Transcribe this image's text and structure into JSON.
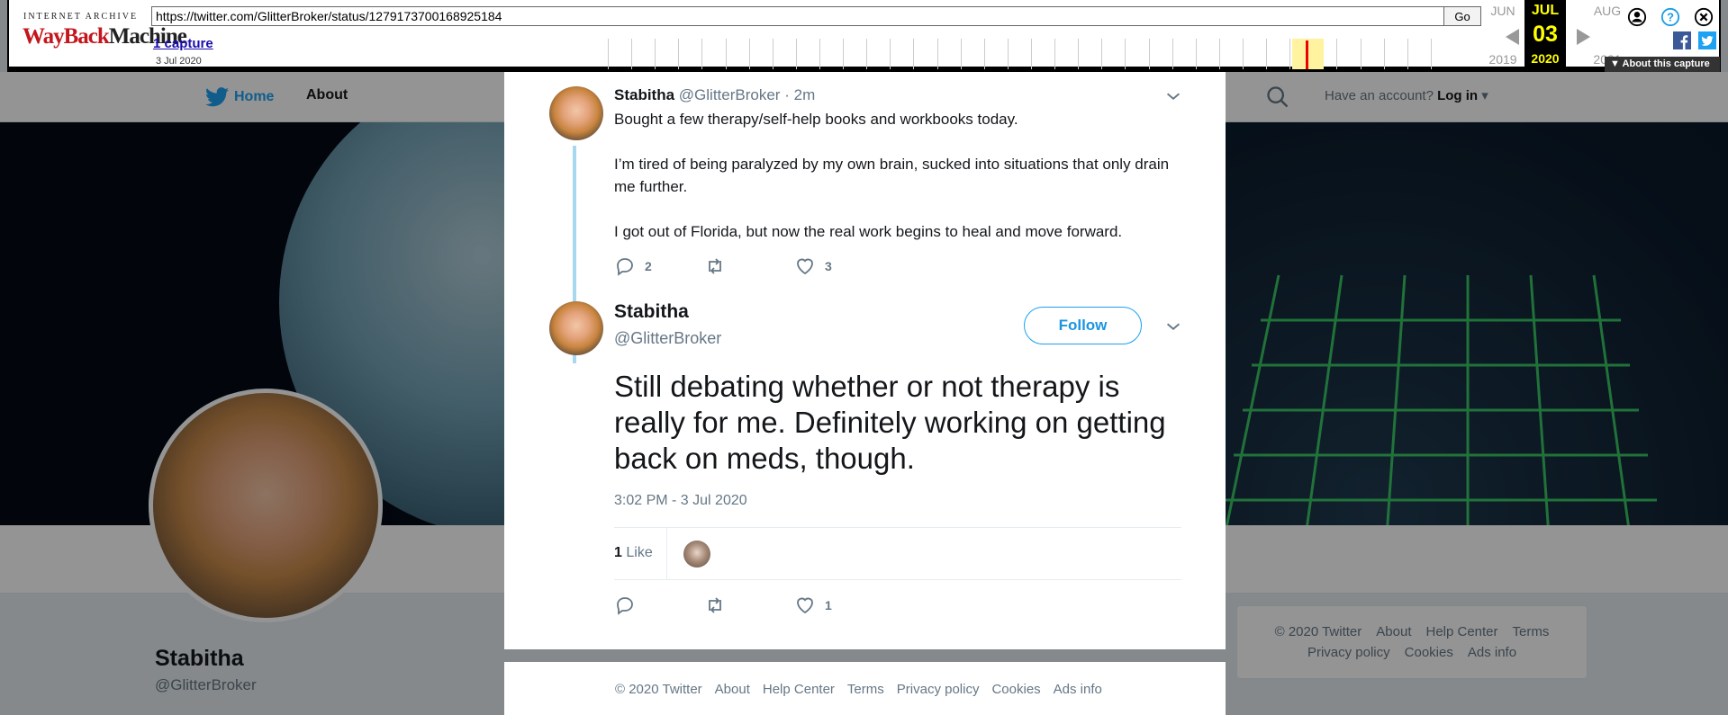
{
  "wayback": {
    "logo_top": "INTERNET ARCHIVE",
    "logo_way": "WayBack",
    "logo_machine": "Machine",
    "url": "https://twitter.com/GlitterBroker/status/1279173700168925184",
    "go_label": "Go",
    "captures_label": "1 capture",
    "capture_date": "3 Jul 2020",
    "prev_month": "JUN",
    "cur_month": "JUL",
    "next_month": "AUG",
    "cur_day": "03",
    "prev_year": "2019",
    "cur_year": "2020",
    "next_year": "2021",
    "about_capture": "About this capture"
  },
  "background_page": {
    "nav": {
      "home": "Home",
      "about": "About",
      "account_prompt": "Have an account?",
      "login": "Log in"
    },
    "profile": {
      "name": "Stabitha",
      "handle": "@GlitterBroker"
    },
    "footer": {
      "row1": [
        "© 2020 Twitter",
        "About",
        "Help Center",
        "Terms"
      ],
      "row2": [
        "Privacy policy",
        "Cookies",
        "Ads info"
      ]
    }
  },
  "thread_tweet": {
    "name": "Stabitha",
    "handle": "@GlitterBroker",
    "time": "2m",
    "paragraphs": [
      "Bought a few therapy/self-help books and workbooks today.",
      "I’m tired of being paralyzed by my own brain, sucked into situations that only drain me further.",
      "I got out of Florida, but now the real work begins to heal and move forward."
    ],
    "replies": "2",
    "retweets": "",
    "likes": "3"
  },
  "main_tweet": {
    "name": "Stabitha",
    "handle": "@GlitterBroker",
    "follow_label": "Follow",
    "text": "Still debating whether or not therapy is really for me. Definitely working on getting back on meds, though.",
    "timestamp": "3:02 PM - 3 Jul 2020",
    "like_count": "1",
    "like_label": "Like",
    "replies": "",
    "retweets": "",
    "likes": "1"
  },
  "modal_footer": [
    "© 2020 Twitter",
    "About",
    "Help Center",
    "Terms",
    "Privacy policy",
    "Cookies",
    "Ads info"
  ],
  "colors": {
    "twitter_blue": "#1da1f2",
    "wayback_red": "#c4161c",
    "highlight_yellow": "#ffff00"
  }
}
